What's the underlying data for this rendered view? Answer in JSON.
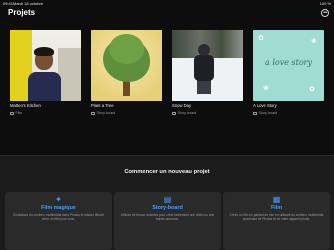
{
  "status_bar": {
    "time": "09:41",
    "date": "Mardi 18 octobre",
    "battery": "100 %"
  },
  "header": {
    "title": "Projets",
    "more_icon": "ellipsis-circle-icon"
  },
  "projects": [
    {
      "title": "Matteo's Kitchen",
      "type": "Film",
      "type_icon": "film-icon"
    },
    {
      "title": "Plant a Tree",
      "type": "Story-board",
      "type_icon": "storyboard-icon"
    },
    {
      "title": "Snow Day",
      "type": "Story-board",
      "type_icon": "storyboard-icon"
    },
    {
      "title": "A Love Story",
      "type": "Story-board",
      "type_icon": "storyboard-icon",
      "thumb_text": "a love story"
    }
  ],
  "new_project": {
    "heading": "Commencer un nouveau projet",
    "options": [
      {
        "title": "Film magique",
        "icon": "magic-wand-icon",
        "description": "Choisissez du contenu multimédia dans Photos et laissez iMovie créer un film pour vous."
      },
      {
        "title": "Story-board",
        "icon": "storyboard-icon",
        "description": "Utilisez de beaux modèles pour créer facilement une vidéo ou une bande-annonce."
      },
      {
        "title": "Film",
        "icon": "film-icon",
        "description": "Créez un film en partant de rien en utilisant du contenu multimédia provenant de Photos et de votre appareil photo."
      }
    ]
  },
  "colors": {
    "background": "#0d0d0d",
    "panel": "#1b1b1b",
    "card": "#2a2a2a",
    "accent": "#4a9ff5"
  }
}
